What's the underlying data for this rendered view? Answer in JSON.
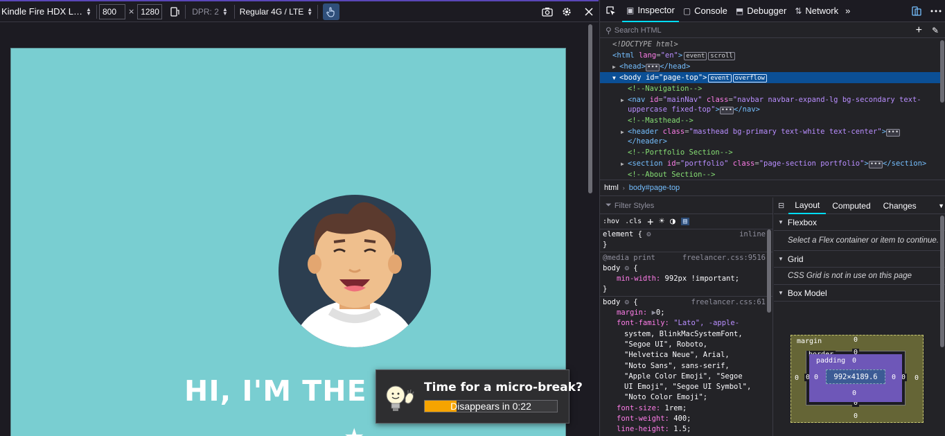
{
  "rdm": {
    "device": "Kindle Fire HDX L…",
    "width": "800",
    "times": "×",
    "height": "1280",
    "dpr": "DPR: 2",
    "throttle": "Regular 4G / LTE"
  },
  "page": {
    "hero_title": "HI, I'M THE C",
    "bg_color": "#79ced1"
  },
  "micro_break": {
    "title": "Time for a micro-break?",
    "countdown": "Disappears in 0:22",
    "progress": 0.24
  },
  "devtools": {
    "tabs": [
      {
        "label": "Inspector",
        "active": true
      },
      {
        "label": "Console"
      },
      {
        "label": "Debugger"
      },
      {
        "label": "Network"
      }
    ],
    "search_placeholder": "Search HTML",
    "markup": {
      "doctype": "<!DOCTYPE html>",
      "html_open": "<html",
      "lang_attr": "lang",
      "lang_val": "\"en\"",
      "gt": ">",
      "badge_event": "event",
      "badge_scroll": "scroll",
      "head": "<head>",
      "head_close": "</head>",
      "body_open": "<body",
      "id_attr": "id",
      "body_id": "\"page-top\"",
      "badge_overflow": "overflow",
      "cmt_nav": "<!--Navigation-->",
      "nav_open": "<nav",
      "nav_id": "\"mainNav\"",
      "class_attr": "class",
      "nav_class1": "\"navbar navbar-expand-lg bg-secondary text-",
      "nav_class2": "uppercase fixed-top\"",
      "nav_close": "</nav>",
      "cmt_mast": "<!--Masthead-->",
      "header_open": "<header",
      "header_class": "\"masthead bg-primary text-white text-center\"",
      "header_close": "</header>",
      "cmt_portfolio": "<!--Portfolio Section-->",
      "section_open": "<section",
      "section_id": "\"portfolio\"",
      "section_class": "\"page-section portfolio\"",
      "section_close": "</section>",
      "cmt_about": "<!--About Section-->",
      "ellipsis": "•••"
    },
    "breadcrumbs": [
      "html",
      "body#page-top"
    ],
    "filter_placeholder": "Filter Styles",
    "rules_tools": [
      ":hov",
      ".cls"
    ],
    "rules": {
      "element_sel": "element {",
      "element_src": "inline",
      "close": "}",
      "media": "@media print",
      "media_src": "freelancer.css:9516",
      "body_sel": "body",
      "open": "{",
      "minwidth_prop": "min-width:",
      "minwidth_val": "992px !important;",
      "body2_src": "freelancer.css:61",
      "margin_prop": "margin:",
      "margin_val": "0;",
      "ff_prop": "font-family:",
      "ff_val1": "\"Lato\", -apple-",
      "ff_val2": "system, BlinkMacSystemFont,",
      "ff_val3": "\"Segoe UI\", Roboto,",
      "ff_val4": "\"Helvetica Neue\", Arial,",
      "ff_val5": "\"Noto Sans\", sans-serif,",
      "ff_val6": "\"Apple Color Emoji\", \"Segoe",
      "ff_val7": "UI Emoji\", \"Segoe UI Symbol\",",
      "ff_val8": "\"Noto Color Emoji\";",
      "fs_prop": "font-size:",
      "fs_val": "1rem;",
      "fw_prop": "font-weight:",
      "fw_val": "400;",
      "lh_prop": "line-height:",
      "lh_val": "1.5;"
    },
    "layout_tabs": [
      "Layout",
      "Computed",
      "Changes"
    ],
    "flexbox": {
      "title": "Flexbox",
      "note": "Select a Flex container or item to continue."
    },
    "grid": {
      "title": "Grid",
      "note": "CSS Grid is not in use on this page"
    },
    "boxmodel": {
      "title": "Box Model",
      "margin_label": "margin",
      "border_label": "border",
      "padding_label": "padding",
      "content": "992×4189.6",
      "zero": "0"
    }
  }
}
